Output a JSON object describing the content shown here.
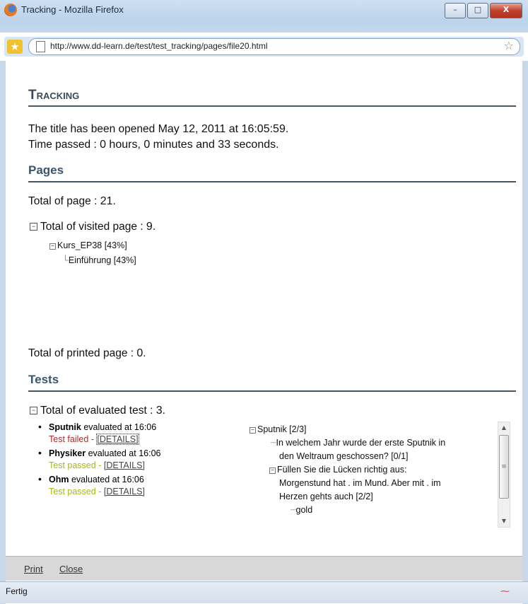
{
  "window": {
    "title": "Tracking - Mozilla Firefox",
    "minimize": "–",
    "maximize": "□",
    "close": "X"
  },
  "address_bar": {
    "url": "http://www.dd-learn.de/test/test_tracking/pages/file20.html"
  },
  "page": {
    "heading": "Tracking",
    "opened_prefix": "The title has been opened ",
    "opened_value": "May 12, 2011 at 16:05:59",
    "opened_suffix": ".",
    "time_prefix": "Time passed : ",
    "time_value": "0 hours, 0 minutes and 33 seconds",
    "time_suffix": "."
  },
  "pages_section": {
    "title": "Pages",
    "total_label": "Total of page : ",
    "total_value": "21",
    "visited_label": "Total of visited page : ",
    "visited_value": "9",
    "tree": [
      {
        "label": "Kurs_EP38 [43%]"
      },
      {
        "label": "Einführung [43%]"
      }
    ],
    "printed_label": "Total of printed page : ",
    "printed_value": "0"
  },
  "tests_section": {
    "title": "Tests",
    "evaluated_label": "Total of evaluated test : ",
    "evaluated_value": "3",
    "evaluated_at": "evaluated at 16:06",
    "details_label": "[DETAILS]",
    "tests": [
      {
        "name": "Sputnik",
        "status": "Test failed"
      },
      {
        "name": "Physiker",
        "status": "Test passed"
      },
      {
        "name": "Ohm",
        "status": "Test passed"
      }
    ],
    "detail_tree": [
      "Sputnik [2/3]",
      "In welchem Jahr wurde der erste Sputnik in",
      "den Weltraum geschossen? [0/1]",
      "Füllen Sie die Lücken richtig aus:",
      "Morgenstund hat . im Mund. Aber mit . im",
      "Herzen gehts auch [2/2]",
      "gold"
    ]
  },
  "footer": {
    "print": "Print",
    "close": "Close"
  },
  "status": {
    "text": "Fertig"
  },
  "colors": {
    "heading": "#3d4a56",
    "section": "#3a5570",
    "failed": "#b02a2a",
    "passed": "#a7b620"
  }
}
